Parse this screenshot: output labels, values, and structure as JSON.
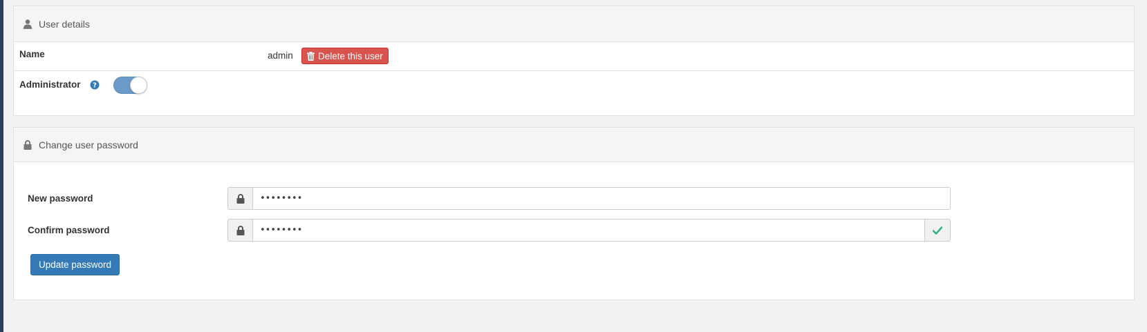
{
  "user_details": {
    "header": "User details",
    "name_label": "Name",
    "username": "admin",
    "delete_button": "Delete this user",
    "admin_label": "Administrator",
    "admin_enabled": true
  },
  "change_password": {
    "header": "Change user password",
    "new_password_label": "New password",
    "new_password_value": "••••••••",
    "confirm_password_label": "Confirm password",
    "confirm_password_value": "••••••••",
    "update_button": "Update password"
  },
  "colors": {
    "danger": "#d9534f",
    "primary": "#337ab7",
    "toggle_on": "#6a9ac8",
    "success": "#3bb07f"
  },
  "icons": [
    "user-icon",
    "trash-icon",
    "question-circle-icon",
    "lock-icon",
    "check-icon"
  ]
}
